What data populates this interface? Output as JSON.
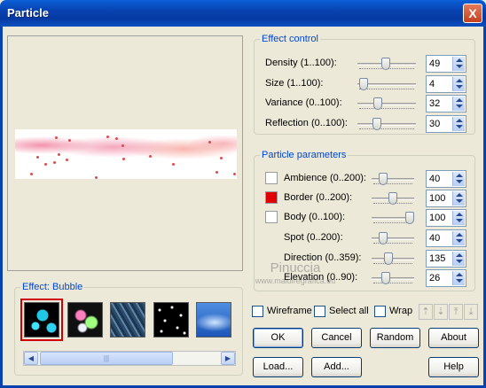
{
  "window": {
    "title": "Particle",
    "close_glyph": "X"
  },
  "effect_control": {
    "legend": "Effect control",
    "rows": [
      {
        "label": "Density (1..100):",
        "value": "49",
        "level": 0.49
      },
      {
        "label": "Size (1..100):",
        "value": "4",
        "level": 0.04
      },
      {
        "label": "Variance (0..100):",
        "value": "32",
        "level": 0.32
      },
      {
        "label": "Reflection (0..100):",
        "value": "30",
        "level": 0.3
      }
    ]
  },
  "particle_parameters": {
    "legend": "Particle parameters",
    "rows": [
      {
        "label": "Ambience (0..200):",
        "value": "40",
        "level": 0.2,
        "swatch": "#ffffff"
      },
      {
        "label": "Border (0..200):",
        "value": "100",
        "level": 0.5,
        "swatch": "#e00000"
      },
      {
        "label": "Body (0..100):",
        "value": "100",
        "level": 1.0,
        "swatch": "#ffffff"
      },
      {
        "label": "Spot (0..200):",
        "value": "40",
        "level": 0.2
      },
      {
        "label": "Direction (0..359):",
        "value": "135",
        "level": 0.376
      },
      {
        "label": "Elevation (0..90):",
        "value": "26",
        "level": 0.29
      }
    ]
  },
  "effects": {
    "legend": "Effect: Bubble",
    "thumbnails": [
      "bubble",
      "flare",
      "rain",
      "stars",
      "sky"
    ],
    "selected_index": 0
  },
  "scrollbar": {
    "left_arrow": "◀",
    "right_arrow": "▶",
    "grip": "|||"
  },
  "options": {
    "wireframe": {
      "label": "Wireframe",
      "checked": false
    },
    "select_all": {
      "label": "Select all",
      "checked": false
    },
    "wrap": {
      "label": "Wrap",
      "checked": false
    }
  },
  "arrows": [
    "⇡",
    "⇣",
    "⤒",
    "⤓"
  ],
  "buttons": {
    "ok": "OK",
    "cancel": "Cancel",
    "random": "Random",
    "about": "About",
    "load": "Load...",
    "add": "Add...",
    "help": "Help"
  },
  "watermark": {
    "main": "Pinuccia",
    "sub": "www.maidiregrafica.eu"
  },
  "colors": {
    "accent": "#0046d5",
    "title_bar": "#0842b0",
    "selected_outline": "#d00000"
  }
}
